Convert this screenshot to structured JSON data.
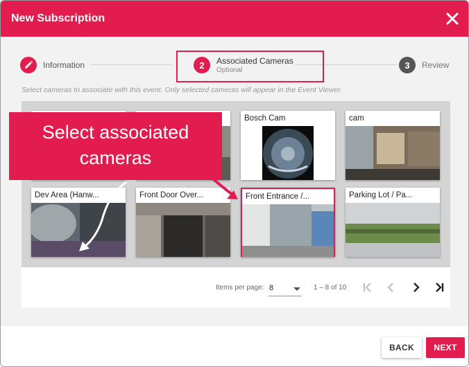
{
  "dialog": {
    "title": "New Subscription"
  },
  "stepper": {
    "steps": [
      {
        "number": "",
        "label": "Information",
        "sub": "",
        "state": "done",
        "icon": "pencil-icon"
      },
      {
        "number": "2",
        "label": "Associated Cameras",
        "sub": "Optional",
        "state": "active"
      },
      {
        "number": "3",
        "label": "Review",
        "sub": "",
        "state": "pending"
      }
    ]
  },
  "hint": "Select cameras to associate with this event. Only selected cameras will appear in the Event Viewer.",
  "cameras": [
    {
      "name": "",
      "selected": false
    },
    {
      "name": "",
      "selected": false
    },
    {
      "name": "Bosch Cam",
      "selected": false
    },
    {
      "name": "cam",
      "selected": false
    },
    {
      "name": "Dev Area (Hanw...",
      "selected": false
    },
    {
      "name": "Front Door Over...",
      "selected": false
    },
    {
      "name": "Front Entrance /...",
      "selected": true
    },
    {
      "name": "Parking Lot / Pa...",
      "selected": false
    }
  ],
  "pagination": {
    "items_per_page_label": "Items per page:",
    "items_per_page": "8",
    "range": "1 – 8 of 10"
  },
  "buttons": {
    "back": "BACK",
    "next": "NEXT"
  },
  "callout": {
    "line1": "Select associated",
    "line2": "cameras"
  },
  "colors": {
    "accent": "#e21c4e",
    "inactive_step": "#555555"
  }
}
